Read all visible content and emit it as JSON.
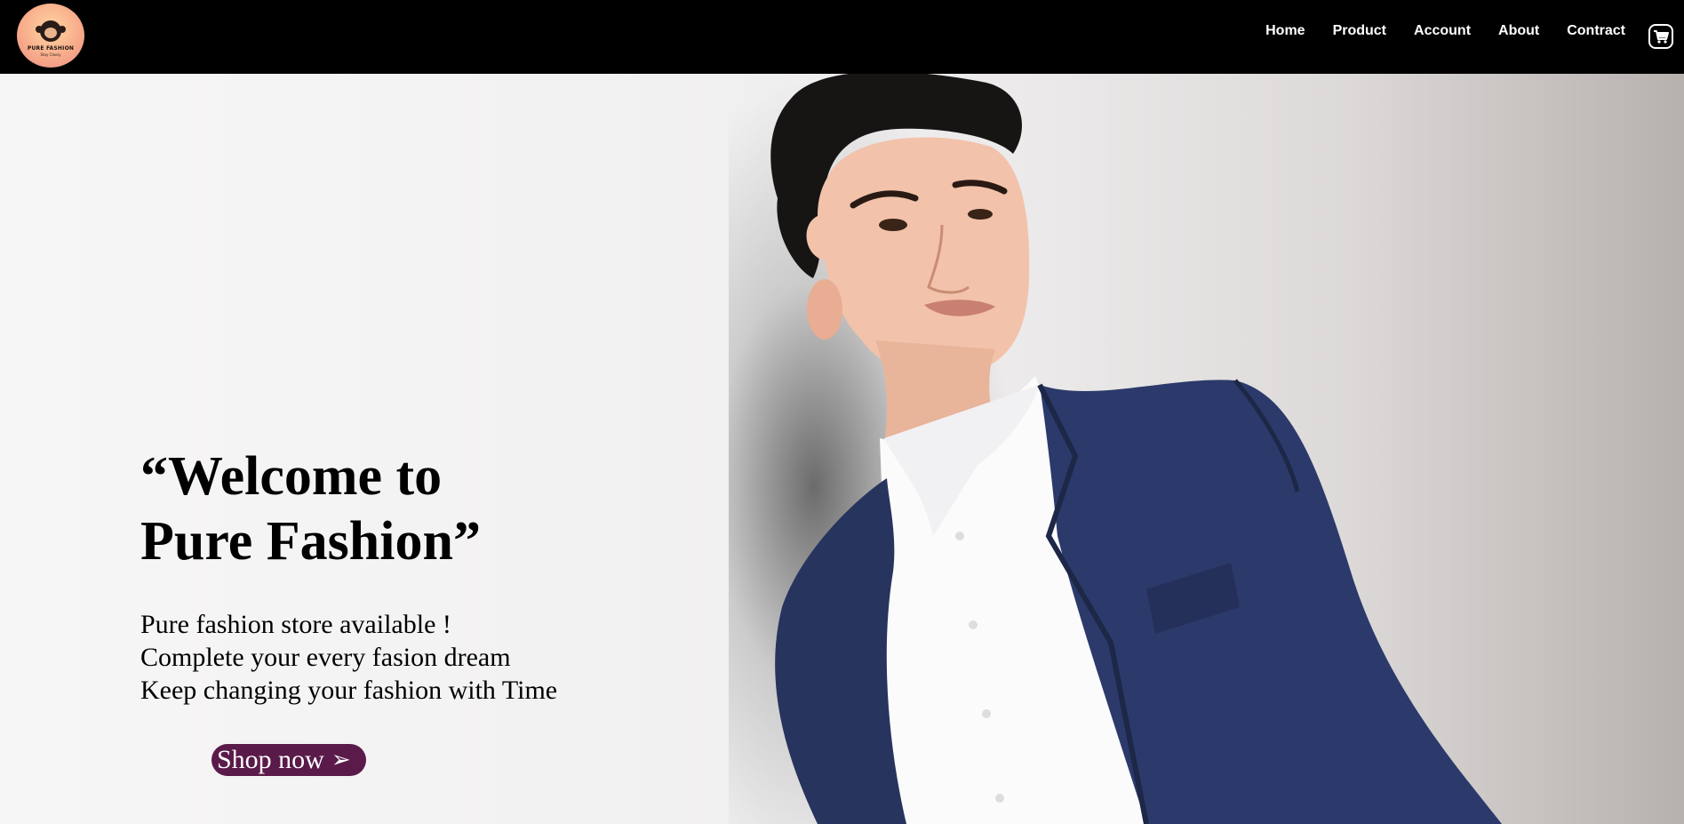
{
  "logo": {
    "brand_text": "PURE FASHION",
    "tagline_text": "Stay Classy"
  },
  "nav": {
    "items": [
      {
        "label": "Home"
      },
      {
        "label": "Product"
      },
      {
        "label": "Account"
      },
      {
        "label": "About"
      },
      {
        "label": "Contract"
      }
    ],
    "cart_icon": "shopping-cart-icon"
  },
  "hero": {
    "headline_line1": "“Welcome to",
    "headline_line2": "Pure Fashion”",
    "lines": [
      "Pure fashion store available !",
      "Complete your every fasion dream",
      "Keep changing your fashion with Time"
    ],
    "cta_label": "Shop now",
    "cta_arrow": "➢",
    "image_subject": "man in navy blazer and white shirt looking upward"
  },
  "colors": {
    "navbar_bg": "#000000",
    "cta_bg": "#5a1a4a",
    "cta_text": "#ffffff",
    "nav_text": "#ffffff"
  }
}
